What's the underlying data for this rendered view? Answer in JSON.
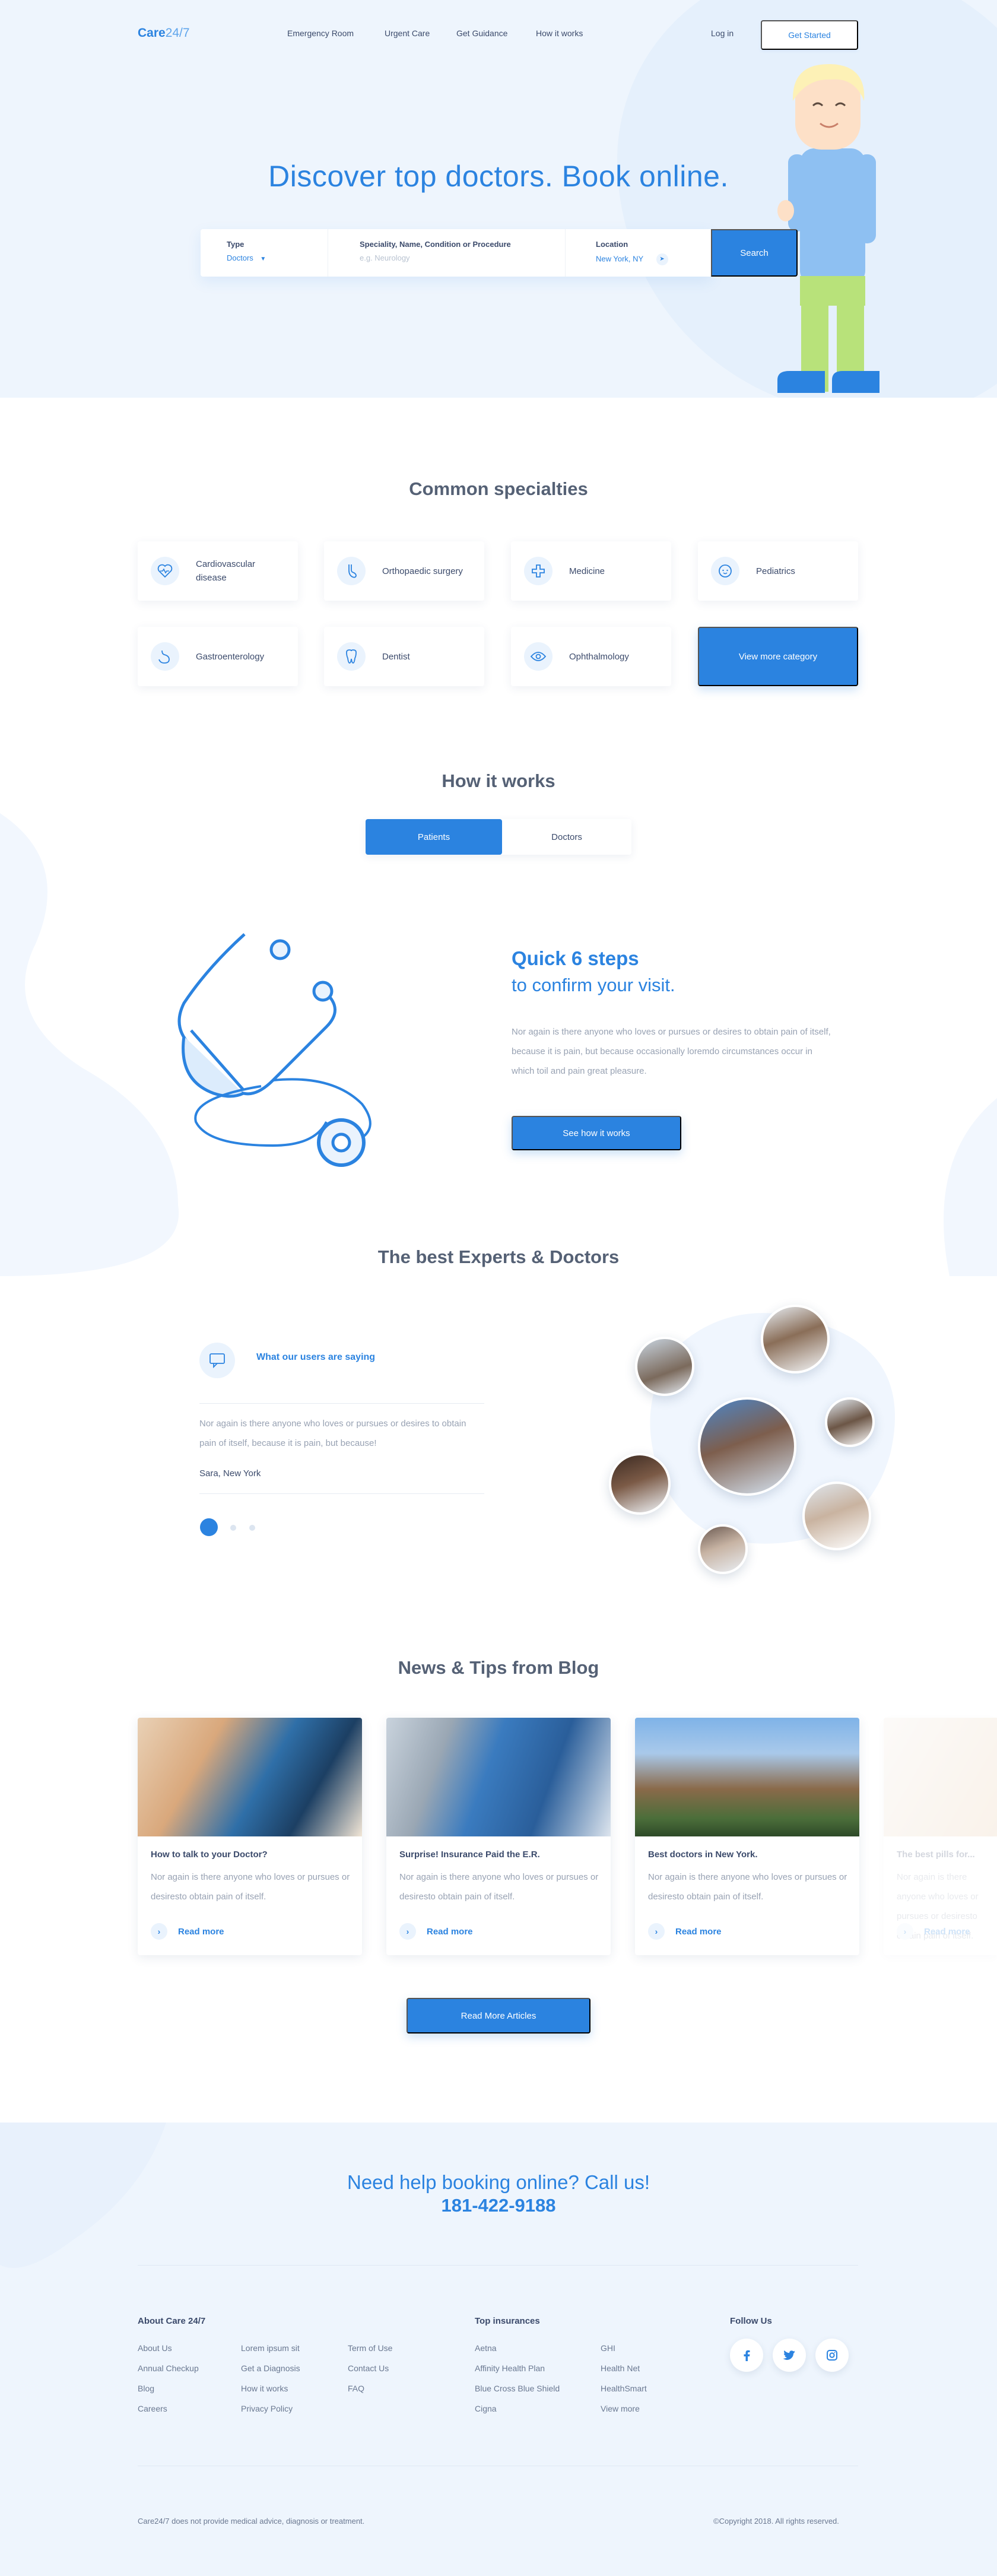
{
  "header": {
    "logo_main": "Care",
    "logo_suffix": "24/7",
    "nav": [
      "Emergency Room",
      "Urgent Care",
      "Get Guidance",
      "How it works"
    ],
    "login_label": "Log in",
    "get_started_label": "Get Started"
  },
  "hero": {
    "title": "Discover top doctors. Book online.",
    "search": {
      "type_label": "Type",
      "type_value": "Doctors",
      "specialty_label": "Speciality, Name, Condition or Procedure",
      "specialty_placeholder": "e.g. Neurology",
      "location_label": "Location",
      "location_value": "New York, NY",
      "button_label": "Search"
    }
  },
  "specialties": {
    "title": "Common specialties",
    "items": [
      {
        "label": "Cardiovascular disease",
        "icon": "heart-pulse-icon"
      },
      {
        "label": "Orthopaedic surgery",
        "icon": "foot-icon"
      },
      {
        "label": "Medicine",
        "icon": "medical-cross-icon"
      },
      {
        "label": "Pediatrics",
        "icon": "baby-face-icon"
      },
      {
        "label": "Gastroenterology",
        "icon": "stomach-icon"
      },
      {
        "label": "Dentist",
        "icon": "tooth-icon"
      },
      {
        "label": "Ophthalmology",
        "icon": "eye-icon"
      }
    ],
    "more_label": "View more category"
  },
  "how_it_works": {
    "title": "How it works",
    "tabs": [
      "Patients",
      "Doctors"
    ],
    "steps_title": "Quick 6 steps",
    "steps_subtitle": "to confirm your visit.",
    "description": "Nor again is there anyone who loves or pursues or desires to obtain pain of itself, because it is pain, but because occasionally loremdo circumstances occur in which toil and pain great pleasure.",
    "button_label": "See how it works"
  },
  "experts": {
    "title": "The best Experts & Doctors",
    "testimonial_heading": "What our users are saying",
    "quote": "Nor again is there anyone who loves or pursues or desires to obtain pain of itself, because it is pain, but because!",
    "author": "Sara, New York"
  },
  "blog": {
    "title": "News & Tips from Blog",
    "posts": [
      {
        "title": "How to talk to your Doctor?",
        "excerpt": "Nor again is there anyone who loves or pursues or desiresto obtain pain of itself.",
        "more": "Read more"
      },
      {
        "title": "Surprise! Insurance Paid the E.R.",
        "excerpt": "Nor again is there anyone who loves or pursues or desiresto obtain pain of itself.",
        "more": "Read more"
      },
      {
        "title": "Best doctors in New York.",
        "excerpt": "Nor again is there anyone who loves or pursues or desiresto obtain pain of itself.",
        "more": "Read more"
      },
      {
        "title": "The best pills for...",
        "excerpt": "Nor again is there anyone who loves or pursues or desiresto obtain pain of itself.",
        "more": "Read more"
      }
    ],
    "read_more_label": "Read More Articles"
  },
  "footer": {
    "cta_text": "Need help booking online? Call us!",
    "phone": "181-422-9188",
    "about_title": "About Care 24/7",
    "about_links": [
      "About Us",
      "Annual Checkup",
      "Blog",
      "Careers",
      "Lorem ipsum sit",
      "Get a Diagnosis",
      "How it works",
      "Privacy Policy",
      "Term of Use",
      "Contact Us",
      "FAQ"
    ],
    "insurance_title": "Top insurances",
    "insurance_links": [
      "Aetna",
      "Affinity Health Plan",
      "Blue Cross Blue Shield",
      "Cigna",
      "GHI",
      "Health Net",
      "HealthSmart",
      "View more"
    ],
    "follow_title": "Follow Us",
    "disclaimer": "Care24/7 does not provide medical advice, diagnosis or treatment.",
    "copyright": "©Copyright 2018. All rights reserved."
  },
  "colors": {
    "accent": "#2b83e0",
    "hero_bg": "#eef5fd",
    "text_dark": "#3b4a6b",
    "text_muted": "#98a2b3"
  }
}
